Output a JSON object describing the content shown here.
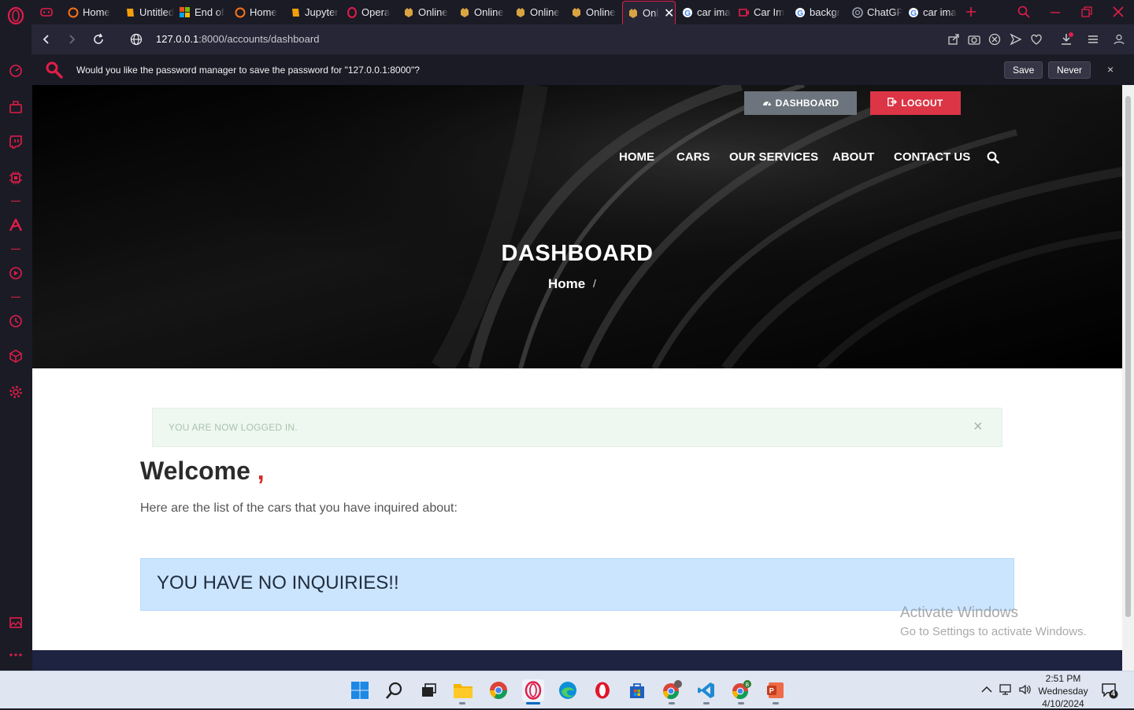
{
  "browser": {
    "tabs": [
      {
        "label": "Home",
        "favicon": "opera-gx-icon"
      },
      {
        "label": "Untitled",
        "favicon": "jupyter-book-icon"
      },
      {
        "label": "End of",
        "favicon": "microsoft-icon"
      },
      {
        "label": "Home",
        "favicon": "opera-gx-icon"
      },
      {
        "label": "Jupyter",
        "favicon": "jupyter-book-icon"
      },
      {
        "label": "Opera",
        "favicon": "opera-icon"
      },
      {
        "label": "Online",
        "favicon": "car-site-icon"
      },
      {
        "label": "Online",
        "favicon": "car-site-icon"
      },
      {
        "label": "Online",
        "favicon": "car-site-icon"
      },
      {
        "label": "Online",
        "favicon": "car-site-icon"
      },
      {
        "label": "Onl",
        "favicon": "car-site-icon",
        "active": true
      },
      {
        "label": "car ima",
        "favicon": "google-icon"
      },
      {
        "label": "Car Im",
        "favicon": "video-icon"
      },
      {
        "label": "backgr",
        "favicon": "google-icon"
      },
      {
        "label": "ChatGP",
        "favicon": "chatgpt-icon"
      },
      {
        "label": "car ima",
        "favicon": "google-icon"
      }
    ],
    "url_host": "127.0.0.1",
    "url_rest": ":8000/accounts/dashboard",
    "password_prompt": "Would you like the password manager to save the password for \"127.0.0.1:8000\"?",
    "save_label": "Save",
    "never_label": "Never",
    "close_label": "×",
    "accent": "#e11d48"
  },
  "page": {
    "dashboard_btn": "DASHBOARD",
    "logout_btn": "LOGOUT",
    "nav": [
      "HOME",
      "CARS",
      "OUR SERVICES",
      "ABOUT",
      "CONTACT US"
    ],
    "hero_title": "DASHBOARD",
    "breadcrumb_home": "Home",
    "breadcrumb_sep": "/",
    "alert_text": "YOU ARE NOW LOGGED IN.",
    "alert_close": "×",
    "welcome_text": "Welcome ",
    "welcome_comma": ",",
    "inquiries_intro": "Here are the list of the cars that you have inquired about:",
    "no_inquiries": "YOU HAVE NO INQUIRIES!!",
    "colors": {
      "dashboard_btn": "#6c757d",
      "logout_btn": "#dc3545",
      "alert_bg": "#eef7f0",
      "info_bg": "#cce5ff",
      "footer": "#1d2340"
    }
  },
  "watermark": {
    "line1": "Activate Windows",
    "line2": "Go to Settings to activate Windows."
  },
  "taskbar": {
    "time": "2:51 PM",
    "day": "Wednesday",
    "date": "4/10/2024",
    "notification_count": "4"
  }
}
